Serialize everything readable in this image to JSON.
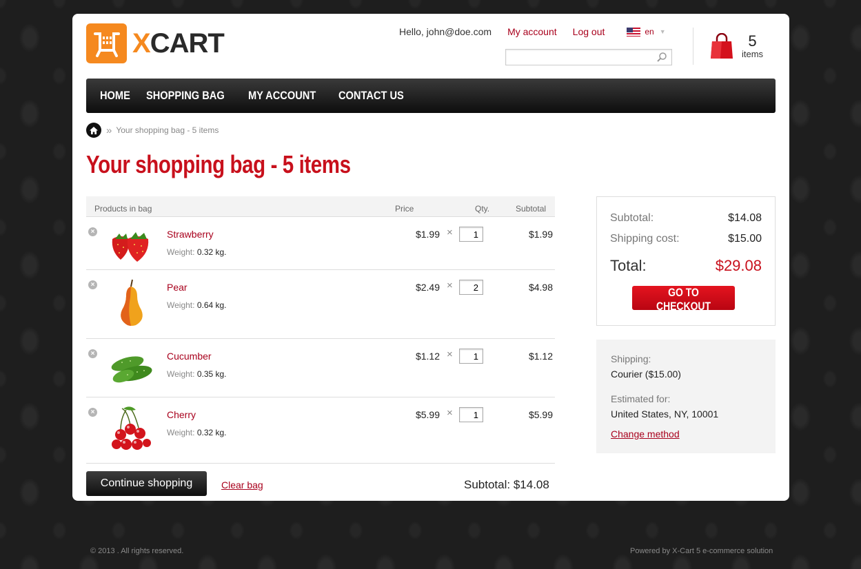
{
  "brand": {
    "logo_x": "X",
    "logo_rest": "CART",
    "accent": "#f5891f"
  },
  "header": {
    "greeting": "Hello, john@doe.com",
    "my_account": "My account",
    "log_out": "Log out",
    "language": "en",
    "search_placeholder": "",
    "cart_count": "5",
    "cart_label": "items"
  },
  "nav": [
    "HOME",
    "SHOPPING BAG",
    "MY ACCOUNT",
    "CONTACT US"
  ],
  "breadcrumb": {
    "separator": "»",
    "current": "Your shopping bag - 5 items"
  },
  "page_title": "Your shopping bag - 5 items",
  "table": {
    "col_products": "Products in bag",
    "col_price": "Price",
    "col_qty": "Qty.",
    "col_subtotal": "Subtotal",
    "weight_label": "Weight:",
    "items": [
      {
        "name": "Strawberry",
        "weight": "0.32 kg.",
        "price": "$1.99",
        "qty": "1",
        "subtotal": "$1.99",
        "thumb": "strawberry-icon"
      },
      {
        "name": "Pear",
        "weight": "0.64 kg.",
        "price": "$2.49",
        "qty": "2",
        "subtotal": "$4.98",
        "thumb": "pear-icon"
      },
      {
        "name": "Cucumber",
        "weight": "0.35 kg.",
        "price": "$1.12",
        "qty": "1",
        "subtotal": "$1.12",
        "thumb": "cucumber-icon"
      },
      {
        "name": "Cherry",
        "weight": "0.32 kg.",
        "price": "$5.99",
        "qty": "1",
        "subtotal": "$5.99",
        "thumb": "cherry-icon"
      }
    ]
  },
  "actions": {
    "continue": "Continue shopping",
    "clear": "Clear bag",
    "subtotal_text": "Subtotal: $14.08"
  },
  "summary": {
    "subtotal_label": "Subtotal:",
    "subtotal_value": "$14.08",
    "shipping_label": "Shipping cost:",
    "shipping_value": "$15.00",
    "total_label": "Total:",
    "total_value": "$29.08",
    "checkout": "GO TO CHECKOUT"
  },
  "shipping": {
    "label": "Shipping:",
    "method": "Courier ($15.00)",
    "estimated_label": "Estimated for:",
    "estimated_value": "United States, NY, 10001",
    "change": "Change method"
  },
  "footer": {
    "copyright": "© 2013 . All rights reserved.",
    "powered": "Powered by X-Cart 5 e-commerce solution"
  }
}
